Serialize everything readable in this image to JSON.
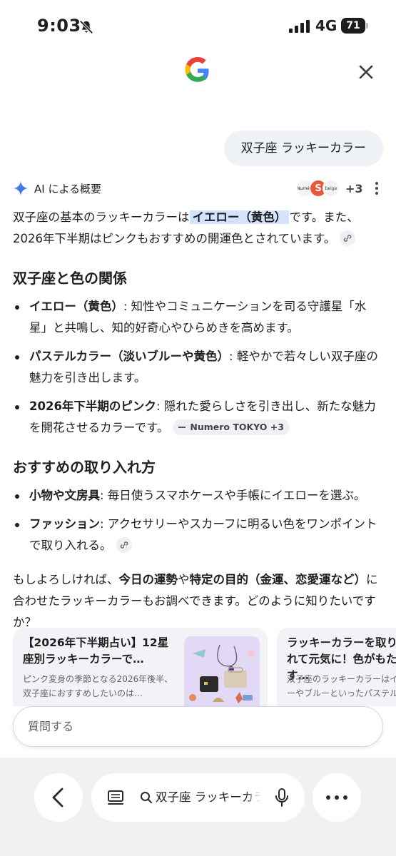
{
  "status_bar": {
    "time": "9:03",
    "network": "4G",
    "battery": "71"
  },
  "query": "双子座 ラッキーカラー",
  "ai_overview": {
    "label": "AI による概要",
    "sources_more": "+3",
    "favicons": [
      "Numéro",
      "S",
      "beige"
    ],
    "intro": {
      "pre": "双子座の基本のラッキーカラーは",
      "highlight": "イエロー（黄色）",
      "post": "です。また、2026年下半期はピンクもおすすめの開運色とされています。"
    },
    "section1": {
      "heading": "双子座と色の関係",
      "items": [
        {
          "term": "イエロー（黄色）",
          "text": ": 知性やコミュニケーションを司る守護星「水星」と共鳴し、知的好奇心やひらめきを高めます。"
        },
        {
          "term": "パステルカラー（淡いブルーや黄色）",
          "text": ": 軽やかで若々しい双子座の魅力を引き出します。"
        },
        {
          "term": "2026年下半期のピンク",
          "text": ": 隠れた愛らしさを引き出し、新たな魅力を開花させるカラーです。",
          "source": "Numero TOKYO +3"
        }
      ]
    },
    "section2": {
      "heading": "おすすめの取り入れ方",
      "items": [
        {
          "term": "小物や文房具",
          "text": ": 毎日使うスマホケースや手帳にイエローを選ぶ。"
        },
        {
          "term": "ファッション",
          "text": ": アクセサリーやスカーフに明るい色をワンポイントで取り入れる。"
        }
      ]
    },
    "closing": {
      "t1": "もしよろしければ、",
      "b1": "今日の運勢",
      "t2": "や",
      "b2": "特定の目的（金運、恋愛運など）",
      "t3": "に合わせたラッキーカラーもお調べできます。どのように知りたいですか？"
    }
  },
  "cards": [
    {
      "title": "【2026年下半期占い】12星座別ラッキーカラーで…",
      "snippet": "ピンク変身の季節となる2026年後半、双子座におすすめしたいのは…"
    },
    {
      "title": "ラッキーカラーを取り入れて元気に！色がもたらす…",
      "snippet": "双子座のラッキーカラーはイエローやブルーといったパステル…"
    }
  ],
  "followup": {
    "placeholder": "質問する"
  },
  "bottom_bar": {
    "query": "双子座 ラッキーカラー"
  },
  "colors": {
    "highlight": "#d3e3fd",
    "chip_bg": "#eef0f3",
    "bottom_bg": "#f0f1f3",
    "accent_blue": "#4285f4"
  }
}
